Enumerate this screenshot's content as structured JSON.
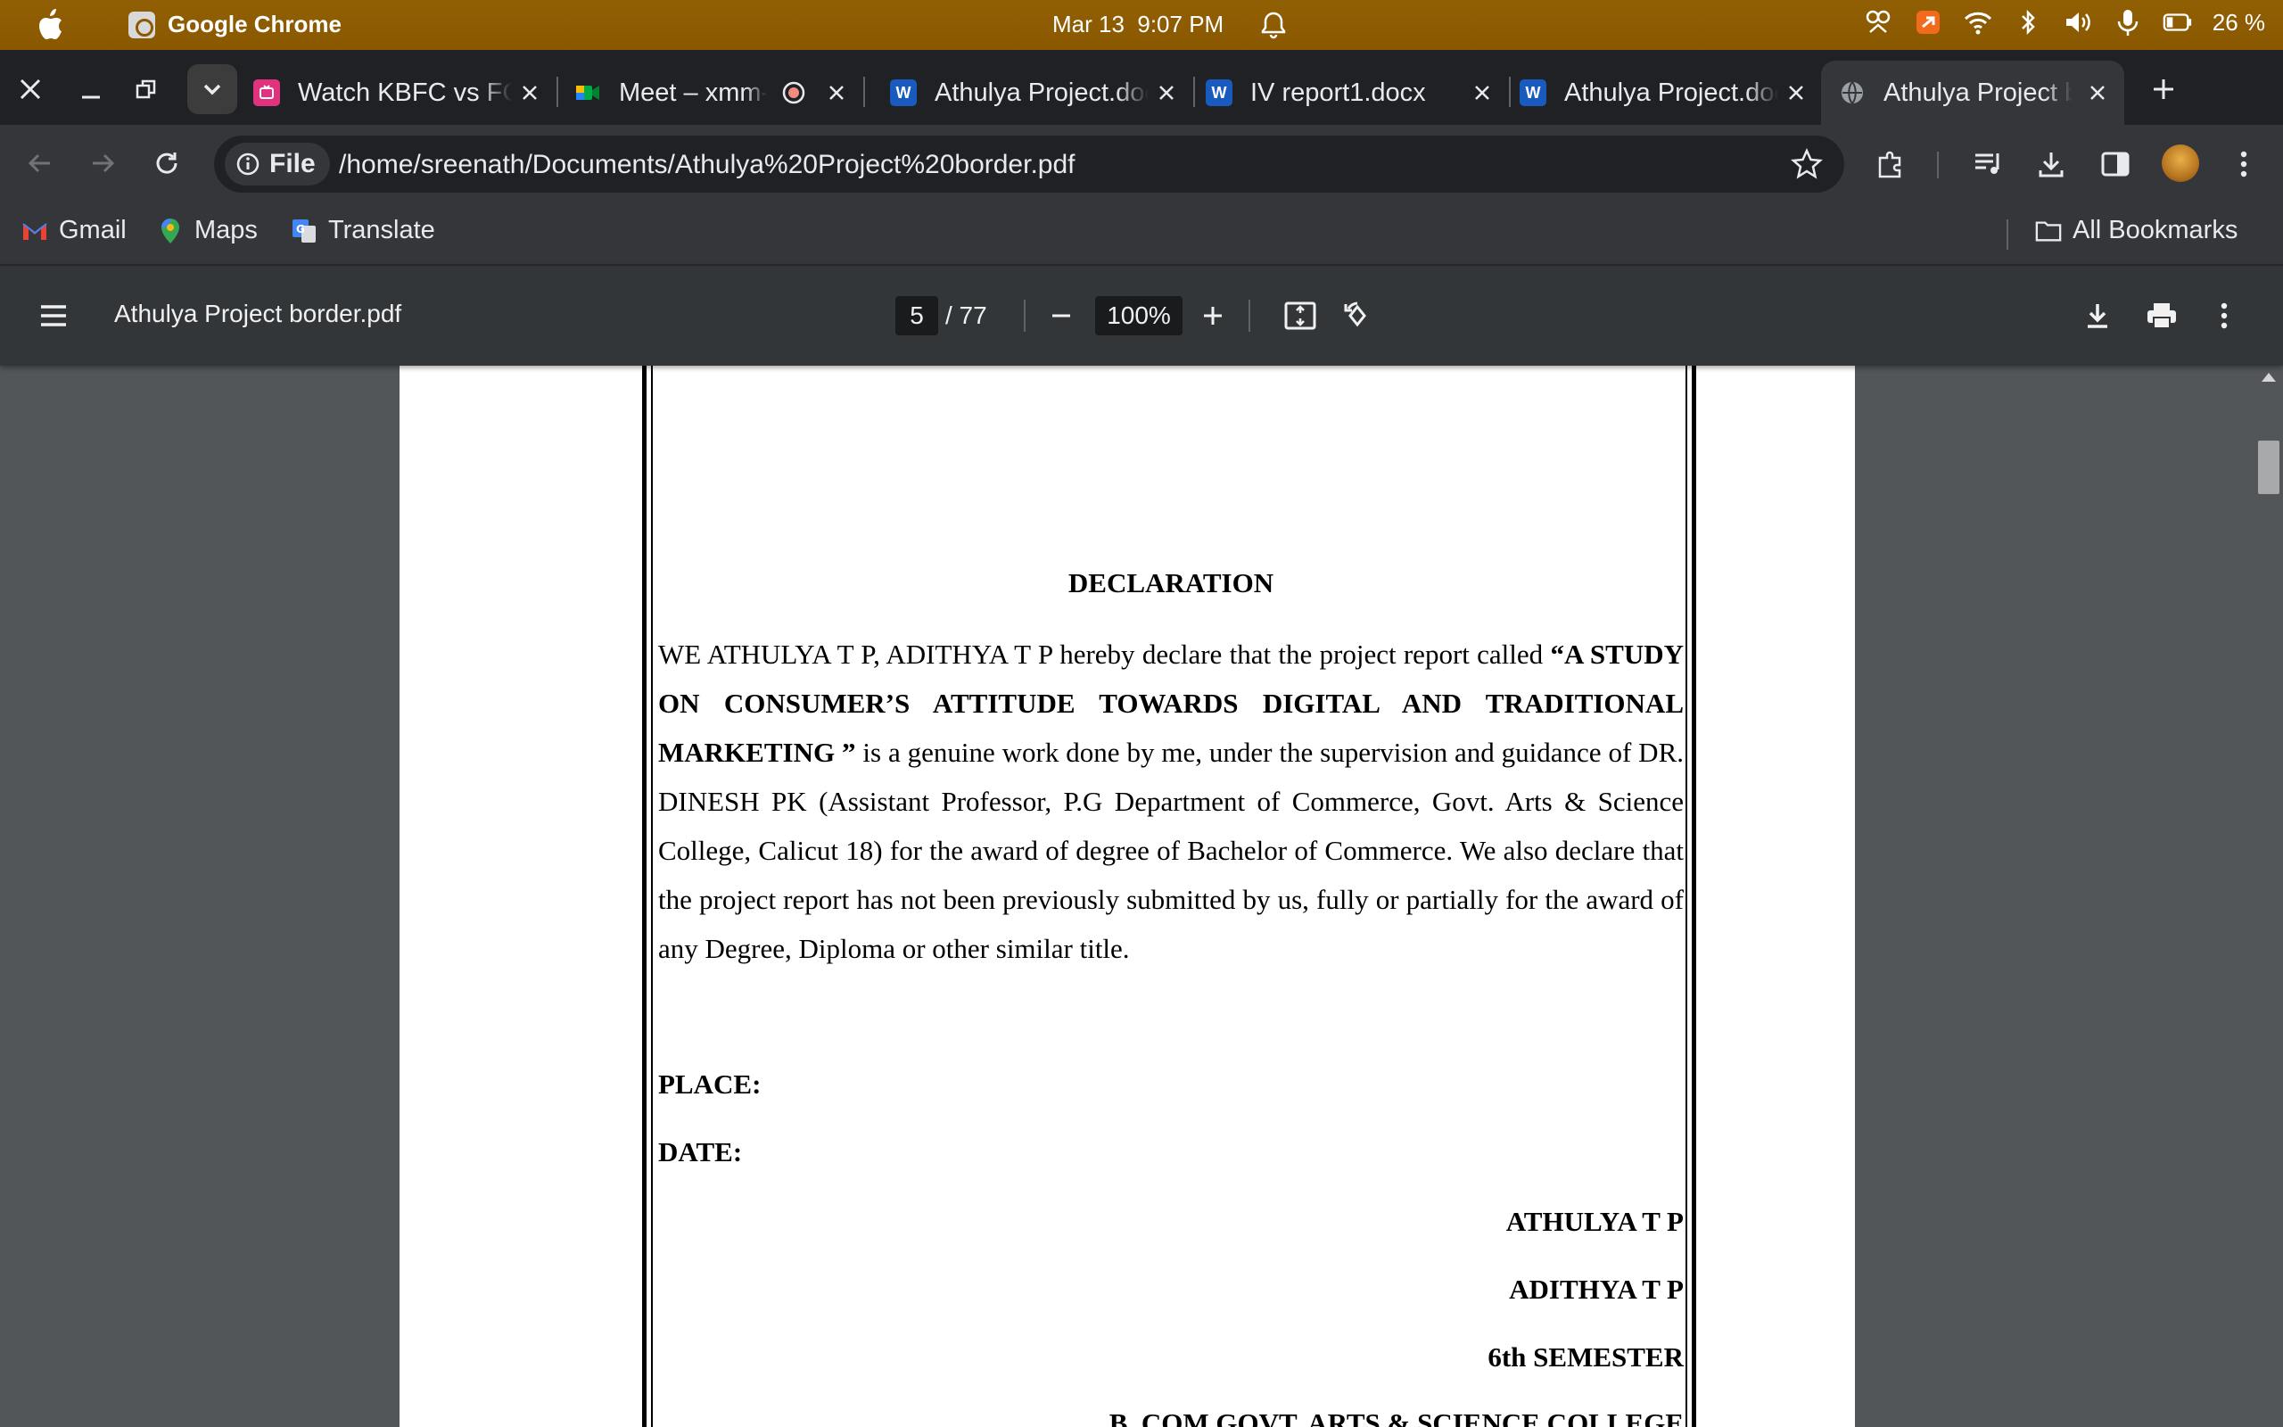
{
  "os": {
    "app_name": "Google Chrome",
    "date": "Mar 13",
    "time": "9:07 PM",
    "battery": "26 %"
  },
  "tabs": [
    {
      "title": "Watch KBFC vs FC Goa",
      "icon": "live-video-icon"
    },
    {
      "title": "Meet – xmm-abcd-efg",
      "icon": "google-meet-icon"
    },
    {
      "title": "Athulya Project.docx",
      "icon": "word-icon"
    },
    {
      "title": "IV report1.docx",
      "icon": "word-icon"
    },
    {
      "title": "Athulya Project.docx",
      "icon": "word-icon"
    },
    {
      "title": "Athulya Project border.pdf",
      "icon": "globe-icon",
      "active": true
    }
  ],
  "omnibox": {
    "chip_label": "File",
    "url": "/home/sreenath/Documents/Athulya%20Project%20border.pdf"
  },
  "bookmarks": {
    "items": [
      {
        "label": "Gmail",
        "icon": "gmail-icon"
      },
      {
        "label": "Maps",
        "icon": "maps-icon"
      },
      {
        "label": "Translate",
        "icon": "translate-icon"
      }
    ],
    "all_label": "All Bookmarks"
  },
  "pdf": {
    "title": "Athulya Project border.pdf",
    "page": "5",
    "page_total": "/ 77",
    "zoom": "100%"
  },
  "document": {
    "heading": "DECLARATION",
    "para_intro": "WE ATHULYA T P, ADITHYA T P hereby declare that the project report called ",
    "para_title": "“A STUDY ON CONSUMER’S ATTITUDE TOWARDS DIGITAL AND TRADITIONAL MARKETING ”",
    "para_rest": " is a genuine work done by me, under the supervision and guidance of DR. DINESH PK (Assistant Professor, P.G Department of Commerce, Govt. Arts & Science College, Calicut 18) for the award of degree of Bachelor of Commerce. We also declare that the project report has not been previously submitted by us, fully or partially for the award of any Degree, Diploma or other similar title.",
    "place_label": "PLACE:",
    "date_label": "DATE:",
    "signatories": [
      "ATHULYA T P",
      "ADITHYA T P",
      "6th SEMESTER",
      "B. COM GOVT. ARTS & SCIENCE COLLEGE"
    ]
  }
}
